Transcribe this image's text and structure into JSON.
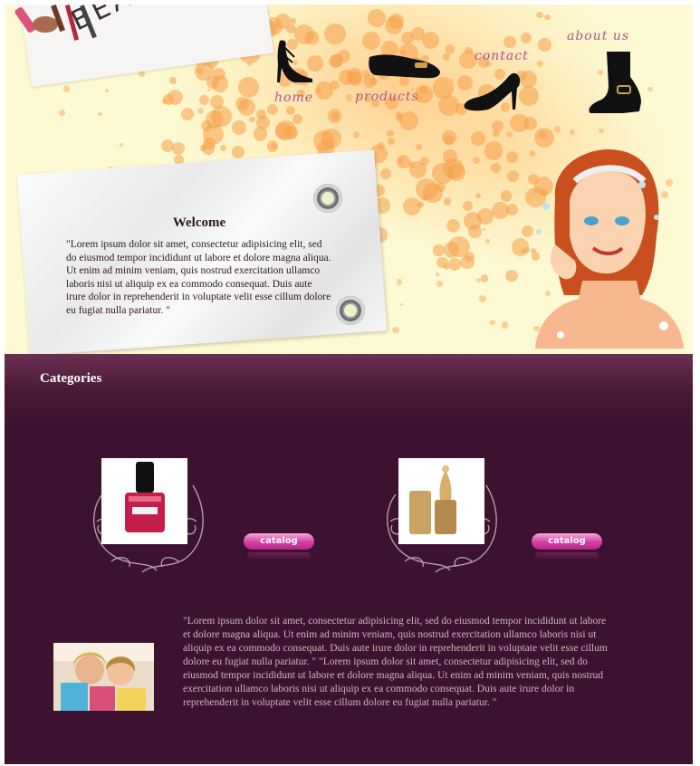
{
  "brand": {
    "logo_text": "BEAUTY co."
  },
  "nav": {
    "items": [
      {
        "label": "home"
      },
      {
        "label": "products"
      },
      {
        "label": "contact"
      },
      {
        "label": "about us"
      }
    ]
  },
  "welcome": {
    "title": "Welcome",
    "text": "\"Lorem ipsum dolor sit amet, consectetur adipisicing elit, sed do eiusmod tempor incididunt ut labore et dolore magna aliqua. Ut enim ad minim veniam, quis nostrud exercitation ullamco laboris nisi ut aliquip ex ea commodo consequat. Duis aute irure dolor in reprehenderit in voluptate velit esse cillum dolore eu fugiat nulla pariatur. \""
  },
  "categories": {
    "title": "Categories",
    "products": [
      {
        "icon": "nail-polish-icon",
        "button_label": "catalog"
      },
      {
        "icon": "perfume-bottle-icon",
        "button_label": "catalog"
      }
    ]
  },
  "body_text": "\"Lorem ipsum dolor sit amet, consectetur adipisicing elit, sed do eiusmod tempor incididunt ut labore et dolore magna aliqua. Ut enim ad minim veniam, quis nostrud exercitation ullamco laboris nisi ut aliquip ex ea commodo consequat. Duis aute irure dolor in reprehenderit in voluptate velit esse cillum dolore eu fugiat nulla pariatur. \" \"Lorem ipsum dolor sit amet, consectetur adipisicing elit, sed do eiusmod tempor incididunt ut labore et dolore magna aliqua. Ut enim ad minim veniam, quis nostrud exercitation ullamco laboris nisi ut aliquip ex ea commodo consequat. Duis aute irure dolor in reprehenderit in voluptate velit esse cillum dolore eu fugiat nulla pariatur. \"",
  "colors": {
    "header_bg": "#fdf9d2",
    "dots": "#f6a04a",
    "nav_link": "#b0538f",
    "content_bg": "#3d1230",
    "catalog_button": "#d13ea4",
    "body_text": "#c9b6c2"
  }
}
